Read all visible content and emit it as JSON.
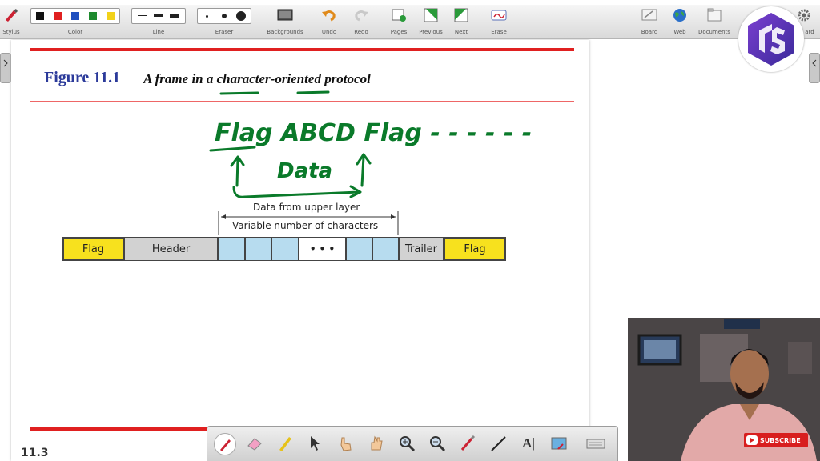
{
  "toolbar": {
    "stylus_label": "Stylus",
    "color_label": "Color",
    "line_label": "Line",
    "eraser_label": "Eraser",
    "backgrounds_label": "Backgrounds",
    "undo_label": "Undo",
    "redo_label": "Redo",
    "pages_label": "Pages",
    "previous_label": "Previous",
    "next_label": "Next",
    "erase_label": "Erase",
    "board_label": "Board",
    "web_label": "Web",
    "documents_label": "Documents",
    "extra_label": "ard",
    "colors": [
      "#111111",
      "#e02020",
      "#1f4fbf",
      "#1e8a2e",
      "#f2d21a"
    ]
  },
  "figure": {
    "number": "Figure 11.1",
    "caption": "A frame in a character-oriented protocol"
  },
  "frame": {
    "data_from_upper_layer": "Data from upper layer",
    "variable_chars": "Variable number of characters",
    "flag_left": "Flag",
    "header": "Header",
    "ellipsis": "• • •",
    "trailer": "Trailer",
    "flag_right": "Flag",
    "flag_color": "#f7e11e",
    "data_cell_color": "#b7dcef"
  },
  "annotation": {
    "text_line": "Flag ABCD Flag - - - - - -",
    "text_data": "Data",
    "ink_color": "#0a7a2a"
  },
  "page_number": "11.3",
  "subscribe_label": "SUBSCRIBE"
}
